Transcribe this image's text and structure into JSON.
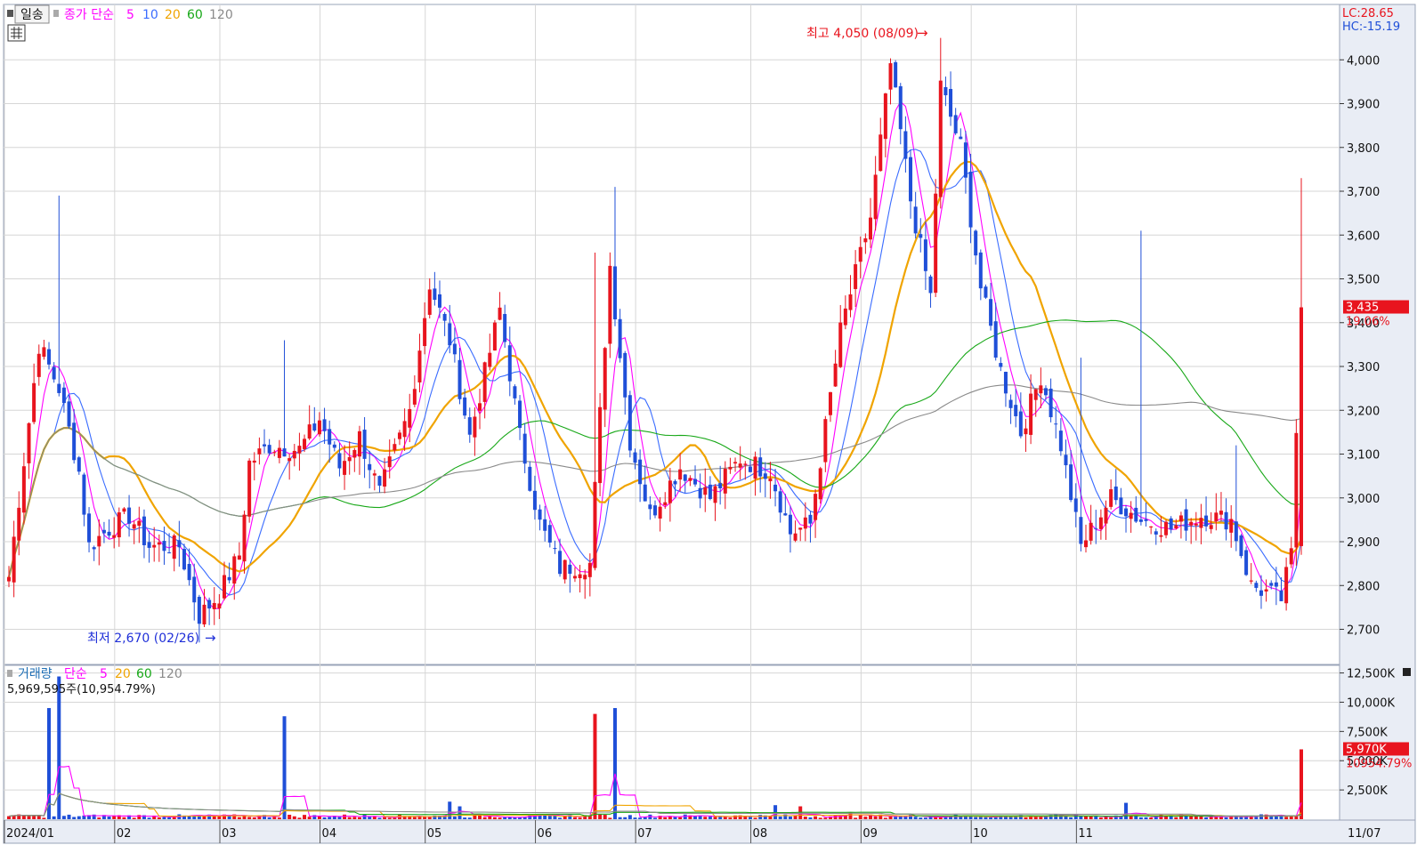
{
  "price_header": {
    "period": "일송",
    "ma_title": "종가 단순",
    "ma_periods": [
      "5",
      "10",
      "20",
      "60",
      "120"
    ],
    "ma_colors": [
      "#ff00ff",
      "#3a6cff",
      "#f0a400",
      "#18a818",
      "#8a8a8a"
    ],
    "lc": "LC:28.65",
    "hc": "HC:-15.19"
  },
  "volume_header": {
    "title": "거래량",
    "ma_title": "단순",
    "ma_periods": [
      "5",
      "20",
      "60",
      "120"
    ],
    "ma_colors": [
      "#ff00ff",
      "#f0a400",
      "#18a818",
      "#8a8a8a"
    ],
    "summary": "5,969,595주(10,954.79%)"
  },
  "annotations": {
    "high": "최고 4,050 (08/09)",
    "low": "최저 2,670 (02/26)"
  },
  "current": {
    "price": "3,435",
    "change": "19.06%",
    "volume": "5,970K",
    "volume_pct": "10954.79%"
  },
  "x_axis": {
    "labels": [
      "2024/01",
      "02",
      "03",
      "04",
      "05",
      "06",
      "07",
      "08",
      "09",
      "10",
      "11"
    ],
    "end_label": "11/07"
  },
  "colors": {
    "up": "#e8141e",
    "down": "#1f4fd8",
    "grid": "#d6d6d6",
    "axis_bg": "#e9edf5"
  },
  "chart_data": [
    {
      "type": "candlestick",
      "title": "",
      "y_ticks": [
        2700,
        2800,
        2900,
        3000,
        3100,
        3200,
        3300,
        3400,
        3500,
        3600,
        3700,
        3800,
        3900,
        4000
      ],
      "ylim": [
        2630,
        4100
      ],
      "high": {
        "value": 4050,
        "date": "08/09"
      },
      "low": {
        "value": 2670,
        "date": "02/26"
      },
      "anchors": [
        [
          0,
          2820
        ],
        [
          6,
          3350
        ],
        [
          10,
          3250
        ],
        [
          14,
          3060
        ],
        [
          16,
          2890
        ],
        [
          20,
          2930
        ],
        [
          24,
          2960
        ],
        [
          28,
          2890
        ],
        [
          34,
          2890
        ],
        [
          38,
          2730
        ],
        [
          42,
          2780
        ],
        [
          46,
          2870
        ],
        [
          48,
          3080
        ],
        [
          52,
          3120
        ],
        [
          58,
          3110
        ],
        [
          62,
          3180
        ],
        [
          66,
          3070
        ],
        [
          70,
          3140
        ],
        [
          74,
          3010
        ],
        [
          80,
          3200
        ],
        [
          84,
          3490
        ],
        [
          88,
          3360
        ],
        [
          92,
          3140
        ],
        [
          98,
          3430
        ],
        [
          102,
          3140
        ],
        [
          106,
          2940
        ],
        [
          110,
          2840
        ],
        [
          116,
          2850
        ],
        [
          120,
          3530
        ],
        [
          124,
          3130
        ],
        [
          128,
          2960
        ],
        [
          134,
          3070
        ],
        [
          140,
          3000
        ],
        [
          146,
          3090
        ],
        [
          152,
          3060
        ],
        [
          156,
          2920
        ],
        [
          160,
          2940
        ],
        [
          166,
          3380
        ],
        [
          172,
          3640
        ],
        [
          176,
          3990
        ],
        [
          180,
          3680
        ],
        [
          184,
          3460
        ],
        [
          186,
          3940
        ],
        [
          190,
          3800
        ],
        [
          194,
          3480
        ],
        [
          198,
          3290
        ],
        [
          202,
          3150
        ],
        [
          206,
          3280
        ],
        [
          210,
          3120
        ],
        [
          214,
          2890
        ],
        [
          220,
          3000
        ],
        [
          226,
          2950
        ],
        [
          232,
          2930
        ],
        [
          238,
          2960
        ],
        [
          244,
          2950
        ],
        [
          248,
          2800
        ],
        [
          254,
          2770
        ],
        [
          256,
          2870
        ],
        [
          258,
          3435
        ]
      ],
      "ma_periods": [
        5,
        10,
        20,
        60,
        120
      ],
      "series": [
        {
          "name": "5"
        },
        {
          "name": "10"
        },
        {
          "name": "20"
        },
        {
          "name": "60"
        },
        {
          "name": "120"
        }
      ]
    },
    {
      "type": "bar",
      "title": "",
      "y_ticks": [
        "2,500K",
        "5,000K",
        "7,500K",
        "10,000K",
        "12,500K"
      ],
      "y_tick_values": [
        2500,
        5000,
        7500,
        10000,
        12500
      ],
      "ylim": [
        0,
        13000
      ],
      "spikes": [
        [
          8,
          9500
        ],
        [
          10,
          12200
        ],
        [
          55,
          8800
        ],
        [
          88,
          1500
        ],
        [
          90,
          1100
        ],
        [
          117,
          9000
        ],
        [
          121,
          9500
        ],
        [
          153,
          1200
        ],
        [
          158,
          1100
        ],
        [
          168,
          600
        ],
        [
          223,
          1400
        ],
        [
          258,
          5970
        ]
      ],
      "base_volume": 300
    }
  ]
}
